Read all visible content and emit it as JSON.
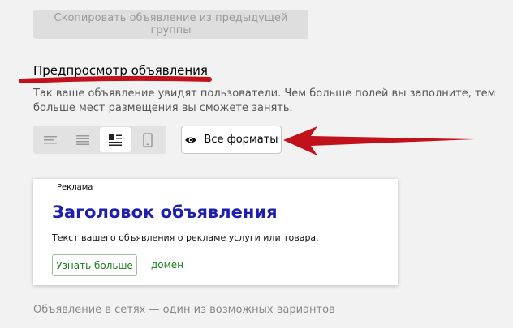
{
  "copy_button": {
    "label": "Скопировать объявление из предыдущей группы"
  },
  "preview": {
    "title": "Предпросмотр объявления",
    "description": "Так ваше объявление увидят пользователи. Чем больше полей вы заполните, тем больше мест размещения вы сможете занять."
  },
  "view_switch": {
    "options": [
      {
        "icon": "text-lines-icon",
        "active": false
      },
      {
        "icon": "text-list-icon",
        "active": false
      },
      {
        "icon": "image-text-icon",
        "active": true
      },
      {
        "icon": "mobile-icon",
        "active": false
      }
    ]
  },
  "formats_button": {
    "label": "Все форматы",
    "icon": "eye-icon"
  },
  "ad": {
    "label": "Реклама",
    "title": "Заголовок объявления",
    "text": "Текст вашего объявления о рекламе услуги или товара.",
    "more_button": "Узнать больше",
    "domain": "домен"
  },
  "footnote": "Объявление в сетях — один из возможных вариантов",
  "colors": {
    "annotation_red": "#c1111a",
    "ad_title": "#1f1fad",
    "ad_green": "#1a7f1a"
  }
}
